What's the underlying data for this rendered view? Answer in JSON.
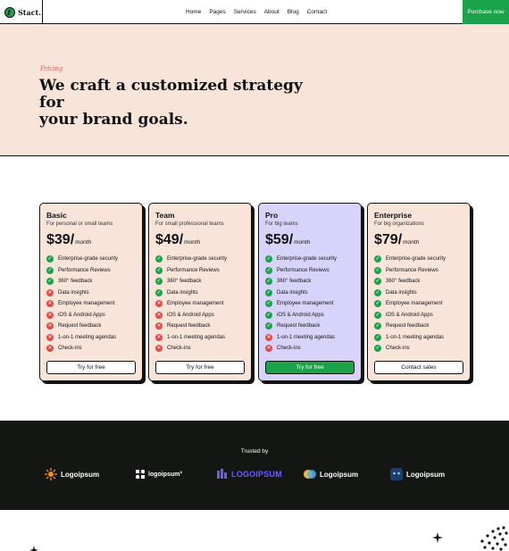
{
  "nav": {
    "logo_text": "Stact.",
    "menu": [
      "Home",
      "Pages",
      "Services",
      "About",
      "Blog",
      "Contact"
    ],
    "cta": "Purchase now"
  },
  "hero": {
    "eyebrow": "Pricing",
    "headline_line1": "We craft a customized strategy for",
    "headline_line2": "your brand goals."
  },
  "plans": [
    {
      "name": "Basic",
      "subtitle": "For personal or small teams",
      "price": "$39/",
      "period": "month",
      "features": [
        {
          "label": "Enterprise-grade security",
          "included": true
        },
        {
          "label": "Performance Reviews",
          "included": true
        },
        {
          "label": "360° feedback",
          "included": true
        },
        {
          "label": "Data insights",
          "included": false
        },
        {
          "label": "Employee management",
          "included": false
        },
        {
          "label": "iOS & Android Apps",
          "included": false
        },
        {
          "label": "Request feedback",
          "included": false
        },
        {
          "label": "1-on-1 meeting agendas",
          "included": false
        },
        {
          "label": "Check-ins",
          "included": false
        }
      ],
      "button": "Try for free"
    },
    {
      "name": "Team",
      "subtitle": "For small professional teams",
      "price": "$49/",
      "period": "month",
      "features": [
        {
          "label": "Enterprise-grade security",
          "included": true
        },
        {
          "label": "Performance Reviews",
          "included": true
        },
        {
          "label": "360° feedback",
          "included": true
        },
        {
          "label": "Data insights",
          "included": true
        },
        {
          "label": "Employee management",
          "included": false
        },
        {
          "label": "iOS & Android Apps",
          "included": false
        },
        {
          "label": "Request feedback",
          "included": false
        },
        {
          "label": "1-on-1 meeting agendas",
          "included": false
        },
        {
          "label": "Check-ins",
          "included": false
        }
      ],
      "button": "Try for free"
    },
    {
      "name": "Pro",
      "subtitle": "For big teams",
      "price": "$59/",
      "period": "month",
      "features": [
        {
          "label": "Enterprise-grade security",
          "included": true
        },
        {
          "label": "Performance Reviews",
          "included": true
        },
        {
          "label": "360° feedback",
          "included": true
        },
        {
          "label": "Data insights",
          "included": true
        },
        {
          "label": "Employee management",
          "included": true
        },
        {
          "label": "iOS & Android Apps",
          "included": true
        },
        {
          "label": "Request feedback",
          "included": true
        },
        {
          "label": "1-on-1 meeting agendas",
          "included": false
        },
        {
          "label": "Check-ins",
          "included": false
        }
      ],
      "button": "Try for free"
    },
    {
      "name": "Enterprise",
      "subtitle": "For big organizations",
      "price": "$79/",
      "period": "month",
      "features": [
        {
          "label": "Enterprise-grade security",
          "included": true
        },
        {
          "label": "Performance Reviews",
          "included": true
        },
        {
          "label": "360° feedback",
          "included": true
        },
        {
          "label": "Data insights",
          "included": true
        },
        {
          "label": "Employee management",
          "included": true
        },
        {
          "label": "iOS & Android Apps",
          "included": true
        },
        {
          "label": "Request feedback",
          "included": true
        },
        {
          "label": "1-on-1 meeting agendas",
          "included": true
        },
        {
          "label": "Check-ins",
          "included": true
        }
      ],
      "button": "Contact sales"
    }
  ],
  "trusted": {
    "label": "Trusted by",
    "logos": [
      "Logoipsum",
      "logoipsum°",
      "LOGOIPSUM",
      "Logoipsum",
      "Logoipsum"
    ]
  },
  "colors": {
    "accent_green": "#1aa34a",
    "hero_bg": "#f9e4da",
    "pro_bg": "#d8d3fb",
    "dark_bg": "#131613",
    "cross_red": "#e24a4a"
  }
}
